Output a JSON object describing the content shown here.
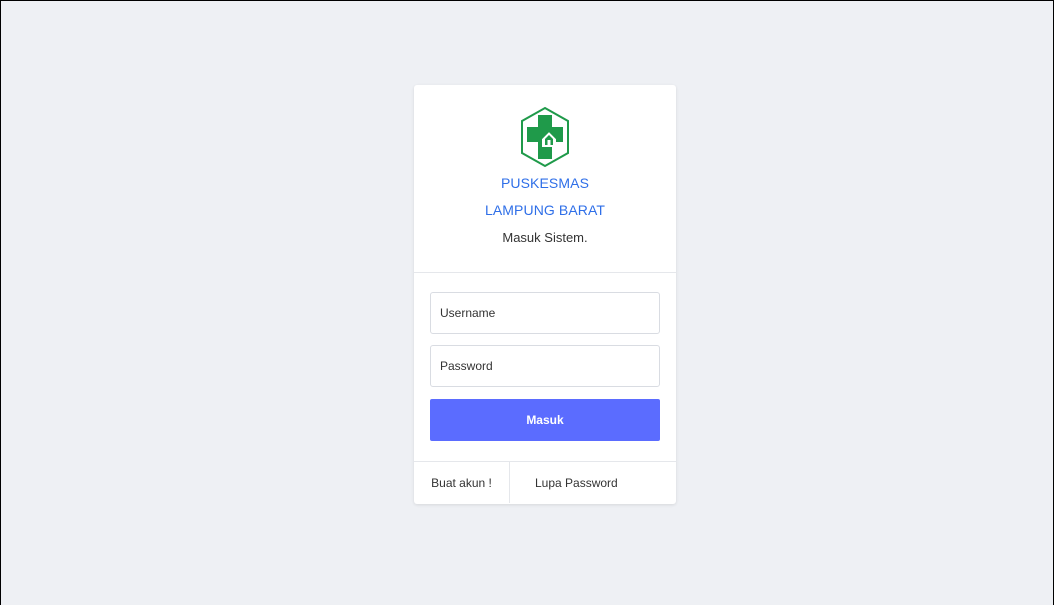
{
  "brand": {
    "line1": "PUSKESMAS",
    "line2": "LAMPUNG BARAT",
    "subtitle": "Masuk Sistem.",
    "logo_icon": "puskesmas-cross-logo",
    "logo_color": "#1f9a4a"
  },
  "form": {
    "username_placeholder": "Username",
    "password_placeholder": "Password",
    "submit_label": "Masuk",
    "submit_color": "#5b6cff"
  },
  "footer": {
    "register_link": "Buat akun !",
    "forgot_link": "Lupa Password"
  }
}
